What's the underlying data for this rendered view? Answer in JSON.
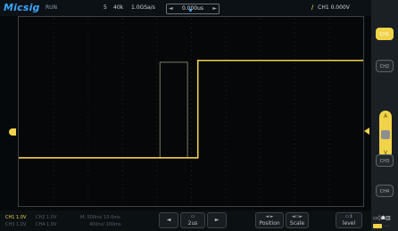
{
  "topbar": {
    "brand": "Micsig",
    "run_state": "RUN",
    "timebase": "5",
    "memory_depth": "40k",
    "sample_rate": "1.0GSa/s",
    "time_position": "0.000us",
    "trigger": {
      "channel": "CH1",
      "level": "0.000V"
    }
  },
  "right_panel": {
    "buttons": [
      {
        "label": "CH1",
        "active": true
      },
      {
        "label": "CH2",
        "active": false
      },
      {
        "label": "CH3",
        "active": false
      },
      {
        "label": "CH4",
        "active": false
      }
    ],
    "knob": {
      "top": "A",
      "bottom": "V"
    }
  },
  "bottom": {
    "channels": [
      {
        "label": "CH1",
        "scale": "1.0V"
      },
      {
        "label": "CH2",
        "scale": "1.0V"
      },
      {
        "label": "CH3",
        "scale": "1.0V"
      },
      {
        "label": "CH4",
        "scale": "1.0V"
      }
    ],
    "timebase_info_1": "M: 500ns/ 10.0ms",
    "timebase_info_2": "400ns/ 100ms",
    "zoom_label": "2us",
    "position_label": "Position",
    "scale_label": "Scale",
    "level_label": "level"
  },
  "colors": {
    "ch1": "#f1d34a",
    "brand": "#3aa6ff",
    "ch2_dim": "#55606a",
    "background": "#050708"
  },
  "waveform": {
    "channel": "CH1",
    "segments": [
      {
        "x0": 0.0,
        "x1": 0.52,
        "level": "low"
      },
      {
        "x0": 0.52,
        "x1": 1.0,
        "level": "high"
      }
    ],
    "ghost_pulse": {
      "x0": 0.41,
      "x1": 0.49,
      "level": "high"
    }
  }
}
